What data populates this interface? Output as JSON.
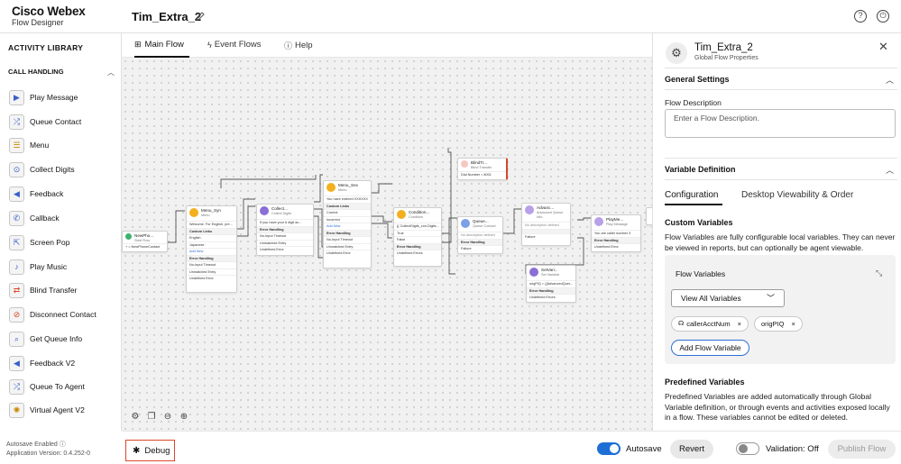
{
  "brand": {
    "title": "Cisco Webex",
    "subtitle": "Flow Designer"
  },
  "flow_name": "Tim_Extra_2",
  "library": {
    "title": "ACTIVITY LIBRARY",
    "section": "CALL HANDLING",
    "items": [
      {
        "label": "Play Message",
        "icon": "play-icon"
      },
      {
        "label": "Queue Contact",
        "icon": "queue-icon"
      },
      {
        "label": "Menu",
        "icon": "menu-icon"
      },
      {
        "label": "Collect Digits",
        "icon": "collect-icon"
      },
      {
        "label": "Feedback",
        "icon": "megaphone-icon"
      },
      {
        "label": "Callback",
        "icon": "phone-icon"
      },
      {
        "label": "Screen Pop",
        "icon": "popout-icon"
      },
      {
        "label": "Play Music",
        "icon": "music-icon"
      },
      {
        "label": "Blind Transfer",
        "icon": "transfer-icon"
      },
      {
        "label": "Disconnect Contact",
        "icon": "disconnect-icon"
      },
      {
        "label": "Get Queue Info",
        "icon": "search-icon"
      },
      {
        "label": "Feedback V2",
        "icon": "megaphone-icon"
      },
      {
        "label": "Queue To Agent",
        "icon": "queue-agent-icon"
      },
      {
        "label": "Virtual Agent V2",
        "icon": "virtual-agent-icon"
      }
    ]
  },
  "status": {
    "autosave": "Autosave Enabled",
    "version": "Application Version: 0.4.252-0"
  },
  "tabs": [
    {
      "label": "Main Flow"
    },
    {
      "label": "Event Flows"
    },
    {
      "label": "Help"
    }
  ],
  "nodes": {
    "newphone": {
      "title": "NewPho...",
      "sub": "Start Flow",
      "line": "+ = NewPhoneContact"
    },
    "menu_syn": {
      "title": "Menu_Syn",
      "sub": "Menu",
      "line": "Welcome. For English, pre...",
      "custom": "Custom Links",
      "l1": "English",
      "l2": "Japanese",
      "add": "Add New",
      "err": "Error Handling",
      "e1": "No-Input Timeout",
      "e2": "Unmatched Entry",
      "e3": "Undefined Error"
    },
    "collect": {
      "title": "Collect...",
      "sub": "Collect Digits",
      "line": "If you have your 6 digit ac...",
      "err": "Error Handling",
      "e1": "No-Input Timeout",
      "e2": "Unmatched Entry",
      "e3": "Undefined Error"
    },
    "menu_sex": {
      "title": "Menu_Sex",
      "sub": "Menu",
      "line": "You have entered XXXXXX",
      "custom": "Custom Links",
      "l1": "Correct",
      "l2": "Incorrect",
      "add": "Add New",
      "err": "Error Handling",
      "e1": "No-Input Timeout",
      "e2": "Unmatched Entry",
      "e3": "Undefined Error"
    },
    "condition": {
      "title": "Condition...",
      "sub": "Condition",
      "line": "{{ CollectDigits_con.Digits...",
      "l1": "True",
      "l2": "False",
      "err": "Error Handling",
      "e1": "Undefined Errors"
    },
    "blind": {
      "title": "BlindTr...",
      "sub": "Blind Transfer",
      "line": "Dial Number = 8001"
    },
    "queue": {
      "title": "Queue...",
      "sub": "Queue Contact",
      "line": "No description defined",
      "err": "Error Handling",
      "e1": "Failure"
    },
    "advanc": {
      "title": "Advanc...",
      "sub": "Advanced Queue Info",
      "line": "No description defined",
      "e1": "Failure"
    },
    "playme": {
      "title": "PlayMe...",
      "sub": "Play Message",
      "line": "You are caller number X",
      "err": "Error Handling",
      "e1": "Undefined Error"
    },
    "setvar": {
      "title": "SetVari...",
      "sub": "Set Variable",
      "line": "origPIQ = {{AdvancedQuer...",
      "err": "Error Handling",
      "e1": "Undefined Errors"
    }
  },
  "bottom": {
    "debug": "Debug",
    "autosave": "Autosave",
    "revert": "Revert",
    "validation": "Validation: Off",
    "publish": "Publish Flow"
  },
  "panel": {
    "title": "Tim_Extra_2",
    "subtitle": "Global Flow Properties",
    "general": "General Settings",
    "flow_desc_label": "Flow Description",
    "flow_desc_placeholder": "Enter a Flow Description.",
    "var_def": "Variable Definition",
    "subtabs": [
      "Configuration",
      "Desktop Viewability & Order"
    ],
    "custom_vars": "Custom Variables",
    "custom_desc": "Flow Variables are fully configurable local variables. They can never be viewed in reports, but can optionally be agent viewable.",
    "flow_vars": "Flow Variables",
    "view_select": "View All Variables",
    "chips": [
      "callerAcctNum",
      "origPIQ"
    ],
    "add_var": "Add Flow Variable",
    "predef": "Predefined Variables",
    "predef_desc": "Predefined Variables are added automatically through Global Variable definition, or through events and activities exposed locally in a flow. These variables cannot be edited or deleted."
  },
  "colors": {
    "accent_blue": "#2f6fd6",
    "toggle_on": "#1d6fd6",
    "debug_border": "#d9472b"
  }
}
